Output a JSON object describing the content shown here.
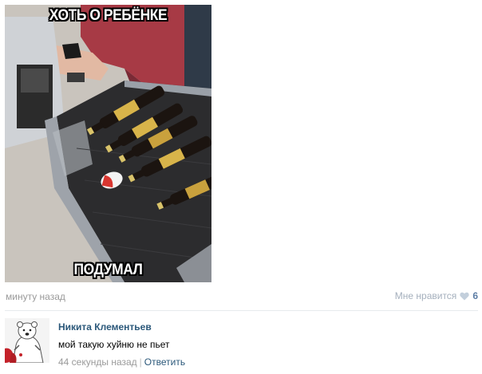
{
  "post": {
    "image": {
      "caption_top": "ХОТЬ О РЕБЁНКЕ",
      "caption_bottom": "ПОДУМАЛ"
    },
    "time": "минуту назад",
    "like_label": "Мне нравится",
    "like_icon": "heart-icon",
    "like_count": "6"
  },
  "comment": {
    "author": "Никита Клементьев",
    "text": "мой такую хуйню не пьет",
    "time": "44 секунды назад",
    "separator": "|",
    "reply_label": "Ответить",
    "avatar_icon": "polar-bear-avatar"
  },
  "colors": {
    "link": "#2b587a",
    "muted": "#999999",
    "like_count": "#5c7da5",
    "heart": "#c3cfdc"
  }
}
